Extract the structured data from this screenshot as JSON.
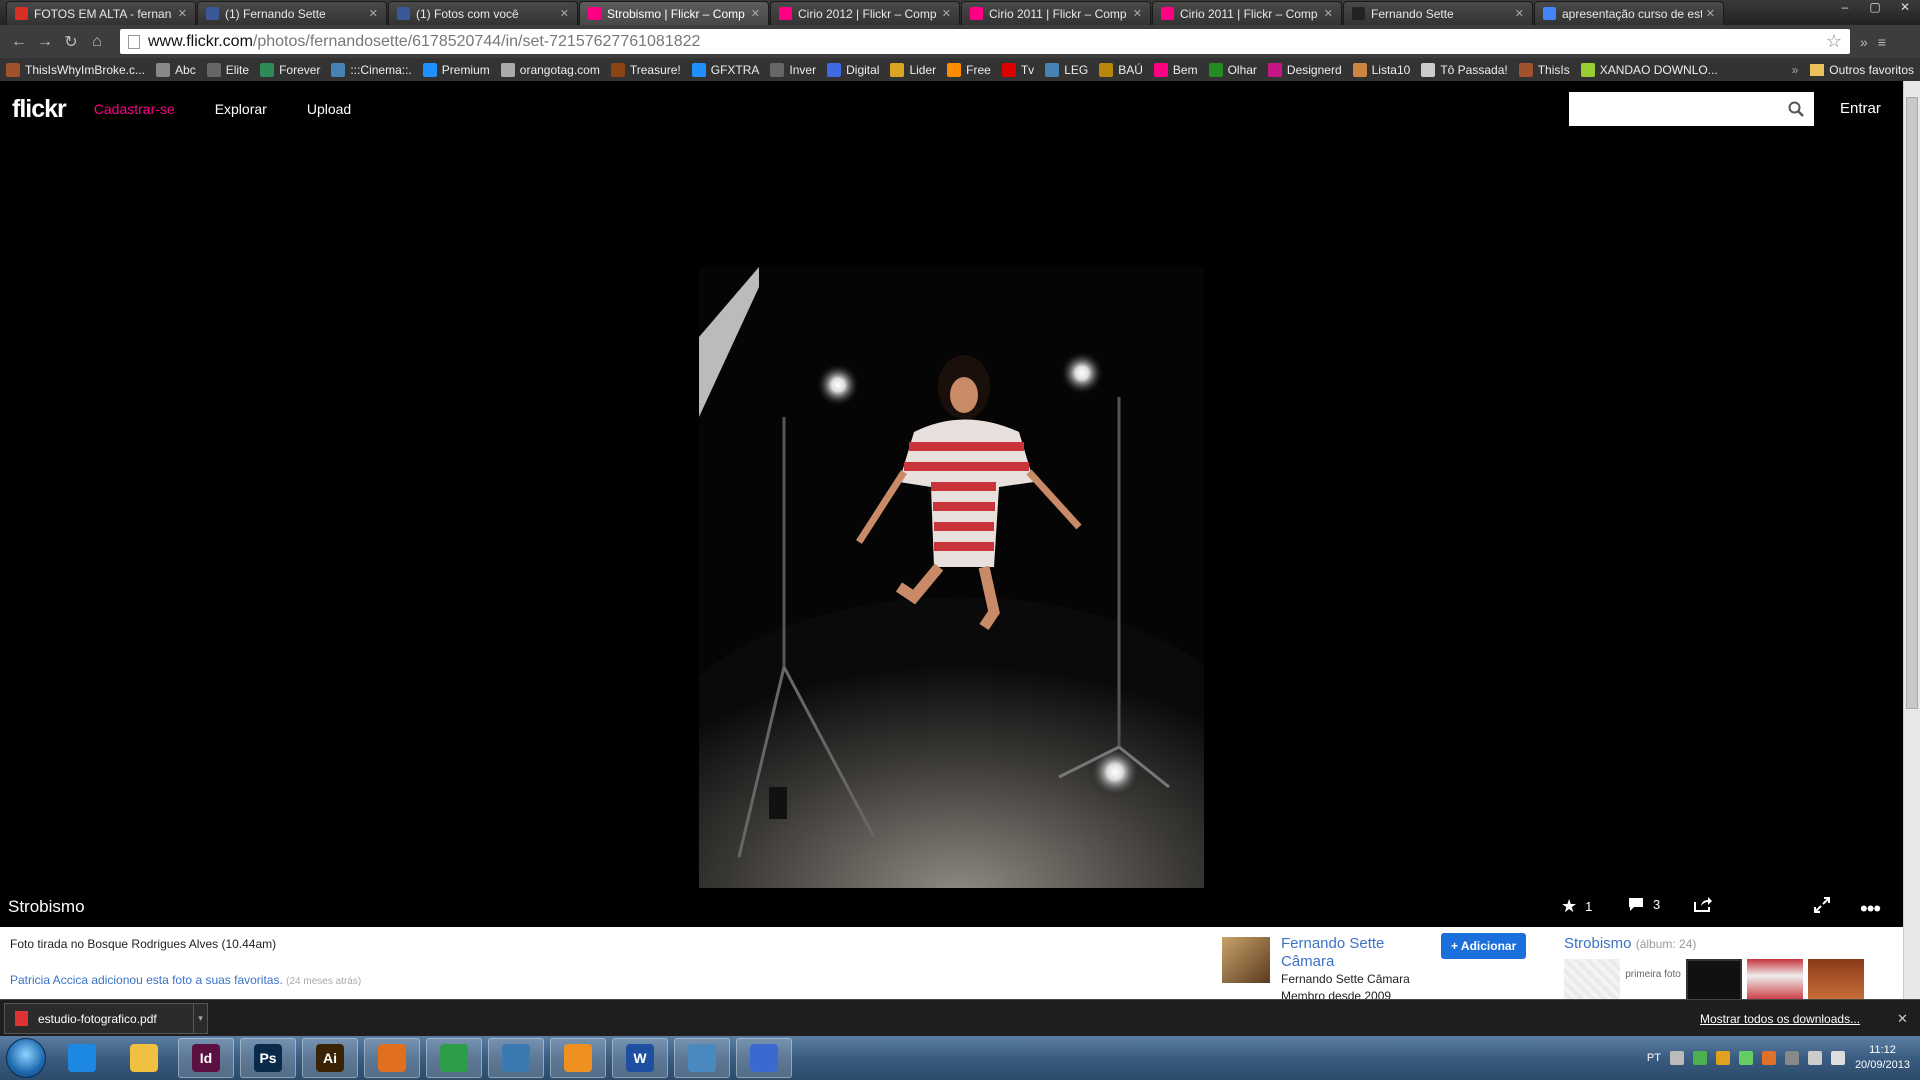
{
  "browser": {
    "tabs": [
      {
        "title": "FOTOS EM ALTA - fernan",
        "color": "#d93025"
      },
      {
        "title": "(1) Fernando Sette",
        "color": "#3b5998"
      },
      {
        "title": "(1) Fotos com você",
        "color": "#3b5998"
      },
      {
        "title": "Strobismo | Flickr – Comp",
        "color": "#ff0084",
        "active": true
      },
      {
        "title": "Cirio 2012 | Flickr – Comp",
        "color": "#ff0084"
      },
      {
        "title": "Cirio 2011 | Flickr – Comp",
        "color": "#ff0084"
      },
      {
        "title": "Cirio 2011 | Flickr – Comp",
        "color": "#ff0084"
      },
      {
        "title": "Fernando Sette",
        "color": "#222"
      },
      {
        "title": "apresentação curso de est",
        "color": "#4285f4"
      }
    ],
    "url_domain": "www.flickr.com",
    "url_path": "/photos/fernandosette/6178520744/in/set-72157627761081822",
    "bookmarks": [
      {
        "label": "ThisIsWhyImBroke.c...",
        "color": "#a0522d"
      },
      {
        "label": "Abc",
        "color": "#888"
      },
      {
        "label": "Elite",
        "color": "#666"
      },
      {
        "label": "Forever",
        "color": "#2e8b57"
      },
      {
        "label": ":::Cinema::.",
        "color": "#4682b4"
      },
      {
        "label": "Premium",
        "color": "#1e90ff"
      },
      {
        "label": "orangotag.com",
        "color": "#aaa"
      },
      {
        "label": "Treasure!",
        "color": "#8b4513"
      },
      {
        "label": "GFXTRA",
        "color": "#1e90ff"
      },
      {
        "label": "Inver",
        "color": "#666"
      },
      {
        "label": "Digital",
        "color": "#4169e1"
      },
      {
        "label": "Lider",
        "color": "#daa520"
      },
      {
        "label": "Free",
        "color": "#ff8c00"
      },
      {
        "label": "Tv",
        "color": "#d00"
      },
      {
        "label": "LEG",
        "color": "#4682b4"
      },
      {
        "label": "BAÚ",
        "color": "#b8860b"
      },
      {
        "label": "Bem",
        "color": "#ff0084"
      },
      {
        "label": "Olhar",
        "color": "#228b22"
      },
      {
        "label": "Designerd",
        "color": "#c71585"
      },
      {
        "label": "Lista10",
        "color": "#cd853f"
      },
      {
        "label": "Tô Passada!",
        "color": "#ccc"
      },
      {
        "label": "ThisIs",
        "color": "#a0522d"
      },
      {
        "label": "XANDAO DOWNLO...",
        "color": "#9acd32"
      }
    ],
    "other_bookmarks": "Outros favoritos"
  },
  "flickr": {
    "logo": "flickr",
    "nav": [
      "Cadastrar-se",
      "Explorar",
      "Upload"
    ],
    "signin": "Entrar",
    "photo_title": "Strobismo",
    "faves": "1",
    "comments": "3",
    "description": "Foto tirada no Bosque Rodrigues Alves (10.44am)",
    "fav_text": "Patricia Accica adicionou esta foto a suas favoritas.",
    "fav_ago": "(24 meses atrás)",
    "owner_name": "Fernando Sette Câmara",
    "owner_realname": "Fernando Sette Câmara",
    "owner_since": "Membro desde 2009",
    "add_button": "+ Adicionar",
    "album_name": "Strobismo",
    "album_count": "(álbum: 24)",
    "first_photo": "primeira foto"
  },
  "downloads": {
    "file": "estudio-fotografico.pdf",
    "show_all": "Mostrar todos os downloads..."
  },
  "taskbar": {
    "apps": [
      "IE",
      "Explorer",
      "InDesign",
      "Photoshop",
      "Illustrator",
      "Media",
      "Chrome",
      "Network",
      "Messenger",
      "Word",
      "Remote",
      "iTunes"
    ],
    "lang": "PT",
    "time": "11:12",
    "date": "20/09/2013"
  }
}
